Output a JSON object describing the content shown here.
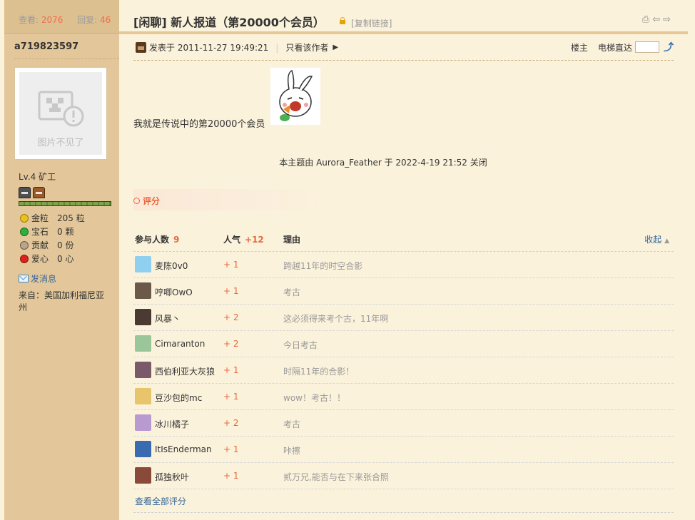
{
  "sidebar": {
    "views_label": "查看:",
    "views": "2076",
    "replies_label": "回复:",
    "replies": "46",
    "username": "a719823597",
    "avatar_placeholder_text": "图片不见了",
    "level": "Lv.4 矿工",
    "xp_progress": 1.0,
    "stats": [
      {
        "label": "金粒",
        "value": "205 粒",
        "icon": "gold-nugget-icon",
        "color": "#e8c21f"
      },
      {
        "label": "宝石",
        "value": "0 颗",
        "icon": "emerald-icon",
        "color": "#2fae3a"
      },
      {
        "label": "贡献",
        "value": "0 份",
        "icon": "contribution-icon",
        "color": "#9c8a72"
      },
      {
        "label": "爱心",
        "value": "0 心",
        "icon": "apple-heart-icon",
        "color": "#d9231b"
      }
    ],
    "send_message": "发消息",
    "from": "来自：美国加利福尼亚州"
  },
  "thread": {
    "title": "[闲聊] 新人报道（第20000个会员）",
    "copy_link": "[复制链接]"
  },
  "post": {
    "posted_at": "发表于 2011-11-27 19:49:21",
    "only_author": "只看该作者",
    "floor": "楼主",
    "jump_label": "电梯直达",
    "content": "我就是传说中的第20000个会员",
    "closed_note": "本主题由 Aurora_Feather 于 2022-4-19 21:52 关闭"
  },
  "rating": {
    "button": "评分",
    "head_participants": "参与人数",
    "participant_count": "9",
    "head_popularity": "人气",
    "popularity_total": "+12",
    "head_reason": "理由",
    "collapse": "收起",
    "rows": [
      {
        "name": "麦陈0v0",
        "score": "+ 1",
        "reason": "跨越11年的时空合影",
        "color": "#8fd0f0"
      },
      {
        "name": "哼唧OwO",
        "score": "+ 1",
        "reason": "考古",
        "color": "#6b5a4a"
      },
      {
        "name": "风暴丶",
        "score": "+ 2",
        "reason": "这必须得来考个古，11年啊",
        "color": "#4a3a34"
      },
      {
        "name": "Cimaranton",
        "score": "+ 2",
        "reason": "今日考古",
        "color": "#9bc59a"
      },
      {
        "name": "西伯利亚大灰狼",
        "score": "+ 1",
        "reason": "时隔11年的合影！",
        "color": "#7a5a6a"
      },
      {
        "name": "豆沙包的mc",
        "score": "+ 1",
        "reason": "wow！考古！！",
        "color": "#e8c46a"
      },
      {
        "name": "冰川橘子",
        "score": "+ 2",
        "reason": "考古",
        "color": "#b89ad0"
      },
      {
        "name": "ItIsEnderman",
        "score": "+ 1",
        "reason": "咔擦",
        "color": "#3a6ab0"
      },
      {
        "name": "孤独秋叶",
        "score": "+ 1",
        "reason": "贰万兄,能否与在下来张合照",
        "color": "#8a4a3a"
      }
    ],
    "view_all": "查看全部评分"
  }
}
